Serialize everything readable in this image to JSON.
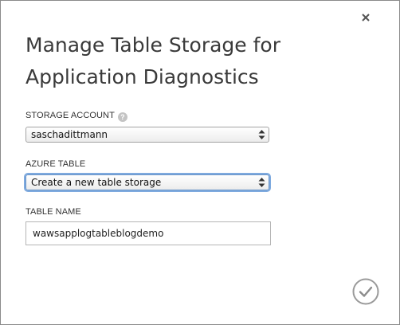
{
  "dialog": {
    "title": "Manage Table Storage for Application Diagnostics",
    "close_icon": "close-icon",
    "ok_icon": "checkmark-circle-icon"
  },
  "storage_account": {
    "label": "STORAGE ACCOUNT",
    "help_icon": "help-icon",
    "help_glyph": "?",
    "selected": "saschadittmann"
  },
  "azure_table": {
    "label": "AZURE TABLE",
    "selected": "Create a new table storage"
  },
  "table_name": {
    "label": "TABLE NAME",
    "value": "wawsapplogtableblogdemo"
  },
  "colors": {
    "title_text": "#3a3a3a",
    "focus_ring": "#7eaadf",
    "icon_gray": "#9a9a9a"
  }
}
